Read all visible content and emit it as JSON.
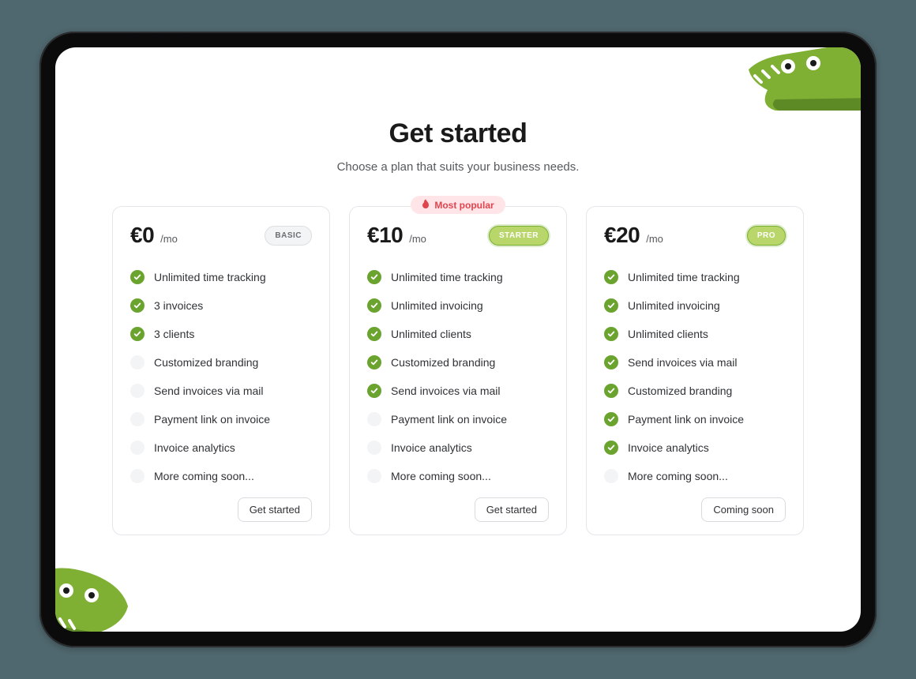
{
  "heading": "Get started",
  "subheading": "Choose a plan that suits your business needs.",
  "popular_label": "Most popular",
  "popular_plan_index": 1,
  "plans": [
    {
      "price": "€0",
      "period": "/mo",
      "tier": "BASIC",
      "tier_style": "grey",
      "cta": "Get started",
      "features": [
        {
          "label": "Unlimited time tracking",
          "included": true
        },
        {
          "label": "3 invoices",
          "included": true
        },
        {
          "label": "3 clients",
          "included": true
        },
        {
          "label": "Customized branding",
          "included": false
        },
        {
          "label": "Send invoices via mail",
          "included": false
        },
        {
          "label": "Payment link on invoice",
          "included": false
        },
        {
          "label": "Invoice analytics",
          "included": false
        },
        {
          "label": "More coming soon...",
          "included": false
        }
      ]
    },
    {
      "price": "€10",
      "period": "/mo",
      "tier": "STARTER",
      "tier_style": "green",
      "cta": "Get started",
      "features": [
        {
          "label": "Unlimited time tracking",
          "included": true
        },
        {
          "label": "Unlimited invoicing",
          "included": true
        },
        {
          "label": "Unlimited clients",
          "included": true
        },
        {
          "label": "Customized branding",
          "included": true
        },
        {
          "label": "Send invoices via mail",
          "included": true
        },
        {
          "label": "Payment link on invoice",
          "included": false
        },
        {
          "label": "Invoice analytics",
          "included": false
        },
        {
          "label": "More coming soon...",
          "included": false
        }
      ]
    },
    {
      "price": "€20",
      "period": "/mo",
      "tier": "PRO",
      "tier_style": "green",
      "cta": "Coming soon",
      "features": [
        {
          "label": "Unlimited time tracking",
          "included": true
        },
        {
          "label": "Unlimited invoicing",
          "included": true
        },
        {
          "label": "Unlimited clients",
          "included": true
        },
        {
          "label": "Send invoices via mail",
          "included": true
        },
        {
          "label": "Customized branding",
          "included": true
        },
        {
          "label": "Payment link on invoice",
          "included": true
        },
        {
          "label": "Invoice analytics",
          "included": true
        },
        {
          "label": "More coming soon...",
          "included": false
        }
      ]
    }
  ]
}
